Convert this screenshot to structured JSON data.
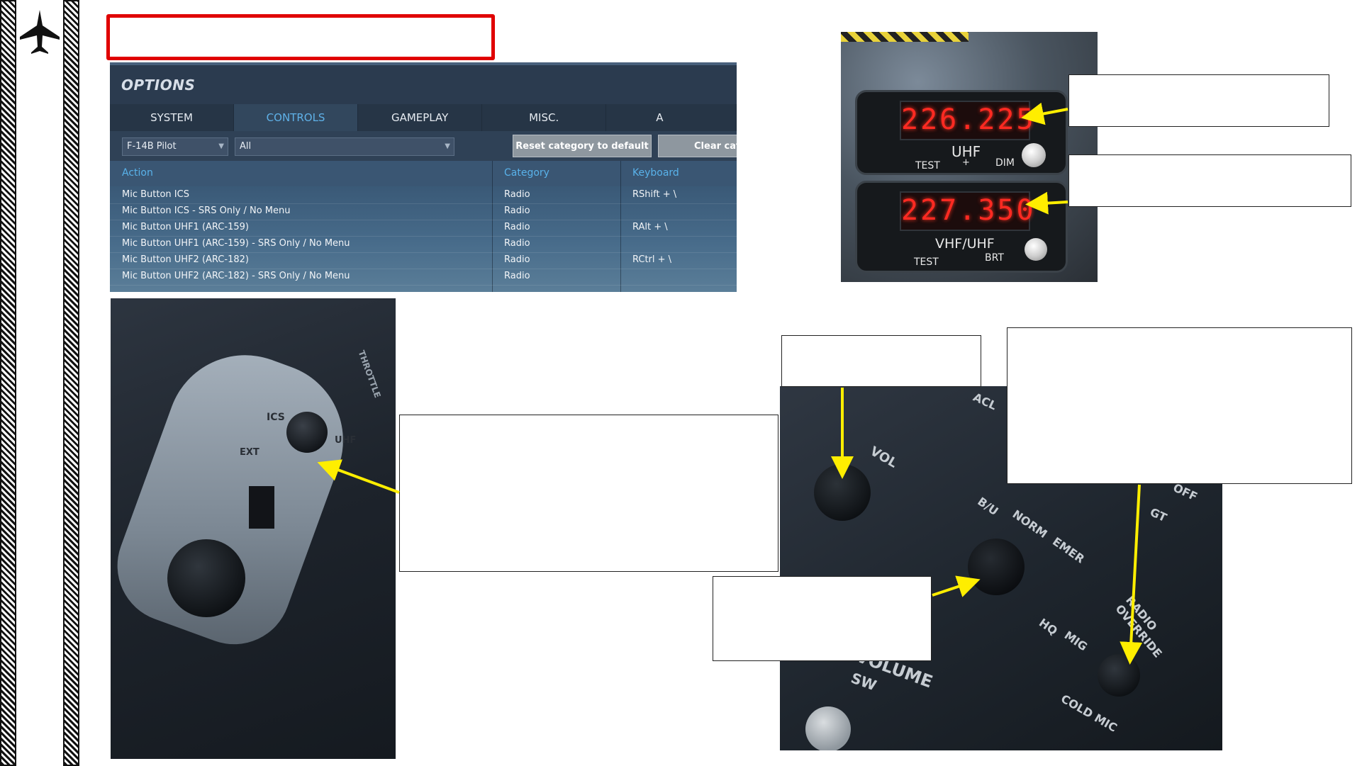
{
  "options": {
    "title": "OPTIONS",
    "tabs": [
      "SYSTEM",
      "CONTROLS",
      "GAMEPLAY",
      "MISC.",
      "A"
    ],
    "active_tab": "CONTROLS",
    "aircraft_select": "F-14B Pilot",
    "category_select": "All",
    "reset_button": "Reset category to default",
    "clear_button": "Clear cat",
    "columns": [
      "Action",
      "Category",
      "Keyboard"
    ],
    "rows": [
      {
        "action": "Mic Button ICS",
        "category": "Radio",
        "keyboard": "RShift + \\"
      },
      {
        "action": "Mic Button ICS - SRS Only / No Menu",
        "category": "Radio",
        "keyboard": ""
      },
      {
        "action": "Mic Button UHF1 (ARC-159)",
        "category": "Radio",
        "keyboard": "RAlt + \\"
      },
      {
        "action": "Mic Button UHF1 (ARC-159) - SRS Only / No Menu",
        "category": "Radio",
        "keyboard": ""
      },
      {
        "action": "Mic Button UHF2 (ARC-182)",
        "category": "Radio",
        "keyboard": "RCtrl + \\"
      },
      {
        "action": "Mic Button UHF2 (ARC-182) - SRS Only / No Menu",
        "category": "Radio",
        "keyboard": ""
      }
    ]
  },
  "radios": {
    "uhf": {
      "freq": "226.225",
      "label": "UHF",
      "test": "TEST",
      "plus": "+",
      "dim": "DIM"
    },
    "vhf": {
      "freq": "227.350",
      "label": "VHF/UHF",
      "test": "TEST",
      "brt": "BRT"
    }
  },
  "throttle": {
    "ics": "ICS",
    "uhf": "UHF",
    "ext": "EXT",
    "throttle": "THROTTLE"
  },
  "panel": {
    "acl": "ACL",
    "vol": "VOL",
    "bu": "B/U",
    "norm": "NORM",
    "emer": "EMER",
    "hq": "HQ",
    "mig": "MIG",
    "radio_override": "RADIO OVERRIDE",
    "cold_mic": "COLD MIC",
    "volume": "VOLUME",
    "sw": "SW",
    "gt": "GT",
    "off": "OFF"
  },
  "colors": {
    "arrow": "#ffee00",
    "red_box": "#e00000",
    "accent": "#5fb1e8"
  },
  "icons": [
    "jet-icon"
  ]
}
